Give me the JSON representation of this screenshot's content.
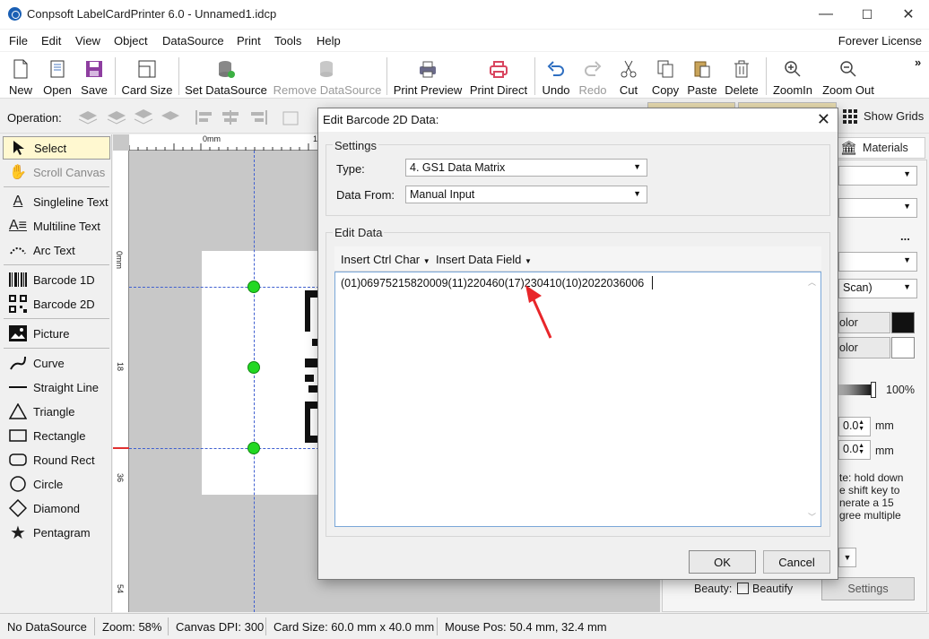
{
  "window": {
    "title": "Conpsoft LabelCardPrinter 6.0 - Unnamed1.idcp",
    "minimize": "—",
    "maximize": "☐",
    "close": "✕"
  },
  "menu": {
    "items": [
      "File",
      "Edit",
      "View",
      "Object",
      "DataSource",
      "Print",
      "Tools",
      "Help"
    ],
    "license": "Forever License"
  },
  "toolbar": {
    "new": "New",
    "open": "Open",
    "save": "Save",
    "card_size": "Card Size",
    "set_datasource": "Set DataSource",
    "remove_datasource": "Remove DataSource",
    "print_preview": "Print Preview",
    "print_direct": "Print Direct",
    "undo": "Undo",
    "redo": "Redo",
    "cut": "Cut",
    "copy": "Copy",
    "paste": "Paste",
    "delete": "Delete",
    "zoom_in": "ZoomIn",
    "zoom_out": "Zoom Out",
    "overflow": "»"
  },
  "operation_bar": {
    "label": "Operation:",
    "show_grids": "Show Grids",
    "materials": "Materials"
  },
  "tools": [
    {
      "label": "Select",
      "icon": "cursor-icon"
    },
    {
      "label": "Scroll Canvas",
      "icon": "hand-icon"
    },
    {
      "label": "Singleline Text",
      "icon": "text-icon"
    },
    {
      "label": "Multiline Text",
      "icon": "multiline-text-icon"
    },
    {
      "label": "Arc Text",
      "icon": "arc-text-icon"
    },
    {
      "label": "Barcode 1D",
      "icon": "barcode-icon"
    },
    {
      "label": "Barcode 2D",
      "icon": "qrcode-icon"
    },
    {
      "label": "Picture",
      "icon": "picture-icon"
    },
    {
      "label": "Curve",
      "icon": "curve-icon"
    },
    {
      "label": "Straight Line",
      "icon": "line-icon"
    },
    {
      "label": "Triangle",
      "icon": "triangle-icon"
    },
    {
      "label": "Rectangle",
      "icon": "rectangle-icon"
    },
    {
      "label": "Round Rect",
      "icon": "round-rect-icon"
    },
    {
      "label": "Circle",
      "icon": "circle-icon"
    },
    {
      "label": "Diamond",
      "icon": "diamond-icon"
    },
    {
      "label": "Pentagram",
      "icon": "star-icon"
    }
  ],
  "ruler": {
    "top_zero": "0mm",
    "left_zero": "0mm",
    "left_ticks": [
      "18",
      "36",
      "54"
    ],
    "top_tick": "1"
  },
  "right_panel": {
    "scan_combo": "Scan)",
    "color1_label": "olor",
    "color2_label": "olor",
    "opacity": "100%",
    "spin1": "0.0",
    "spin1_unit": "mm",
    "spin2": "0.0",
    "spin2_unit": "mm",
    "note_lines": [
      "te: hold down",
      "e shift key to",
      "nerate a 15",
      "gree multiple"
    ],
    "beauty_label": "Beauty:",
    "beautify_label": "Beautify",
    "settings_button": "Settings",
    "dots": "..."
  },
  "status": {
    "datasource": "No DataSource",
    "zoom": "Zoom: 58%",
    "dpi": "Canvas DPI: 300",
    "card_size": "Card Size: 60.0 mm x 40.0 mm",
    "mouse_pos": "Mouse Pos: 50.4 mm, 32.4 mm"
  },
  "dialog": {
    "title": "Edit Barcode 2D Data:",
    "close": "✕",
    "settings_group": "Settings",
    "type_label": "Type:",
    "type_value": "4.  GS1 Data Matrix",
    "datafrom_label": "Data From:",
    "datafrom_value": "Manual Input",
    "edit_group": "Edit Data",
    "insert_ctrl_char": "Insert Ctrl Char",
    "insert_data_field": "Insert Data Field",
    "data_value": "(01)06975215820009(11)220460(17)230410(10)2022036006",
    "ok": "OK",
    "cancel": "Cancel"
  },
  "colors": {
    "accent_blue": "#1a5fb4",
    "annotation_arrow": "#e8262a",
    "selection_handle": "#22d822",
    "print_direct_icon": "#d9455f"
  }
}
